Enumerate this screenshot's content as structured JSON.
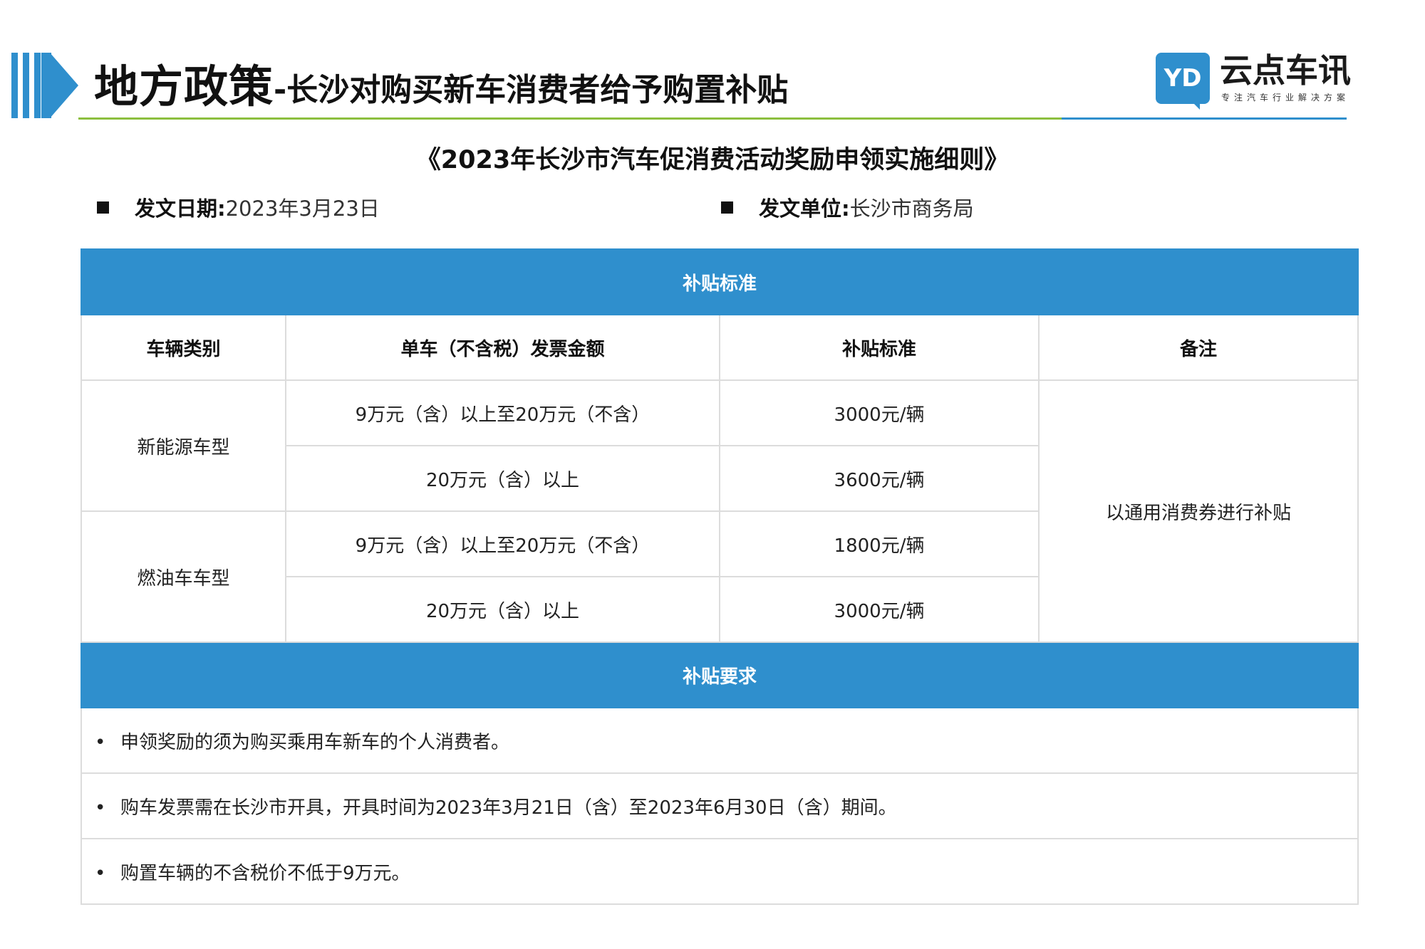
{
  "header": {
    "title_main": "地方政策",
    "title_sub": "-长沙对购买新车消费者给予购置补贴",
    "accent_color": "#2f8fcd",
    "rule_color": "#8cbf3f"
  },
  "logo": {
    "mark": "YD",
    "name": "云点车讯",
    "slogan": "专注汽车行业解决方案"
  },
  "document": {
    "title": "《2023年长沙市汽车促消费活动奖励申领实施细则》",
    "date_label": "发文日期:",
    "date_value": "2023年3月23日",
    "issuer_label": "发文单位:",
    "issuer_value": "长沙市商务局"
  },
  "table": {
    "section1_title": "补贴标准",
    "columns": [
      "车辆类别",
      "单车（不含税）发票金额",
      "补贴标准",
      "备注"
    ],
    "groups": [
      {
        "category": "新能源车型",
        "rows": [
          {
            "amount": "9万元（含）以上至20万元（不含）",
            "subsidy": "3000元/辆"
          },
          {
            "amount": "20万元（含）以上",
            "subsidy": "3600元/辆"
          }
        ]
      },
      {
        "category": "燃油车车型",
        "rows": [
          {
            "amount": "9万元（含）以上至20万元（不含）",
            "subsidy": "1800元/辆"
          },
          {
            "amount": "20万元（含）以上",
            "subsidy": "3000元/辆"
          }
        ]
      }
    ],
    "remark": "以通用消费券进行补贴",
    "section2_title": "补贴要求",
    "bullet": "•",
    "requirements": [
      "申领奖励的须为购买乘用车新车的个人消费者。",
      "购车发票需在长沙市开具，开具时间为2023年3月21日（含）至2023年6月30日（含）期间。",
      "购置车辆的不含税价不低于9万元。"
    ]
  }
}
